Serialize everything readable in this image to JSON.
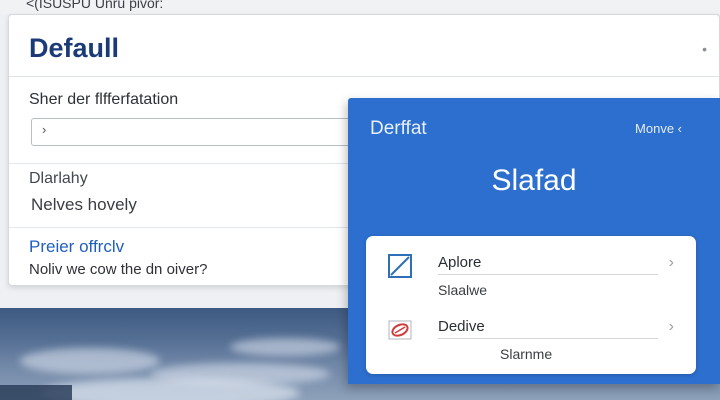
{
  "colors": {
    "accent_blue": "#2d6fce",
    "title_navy": "#1b3b78",
    "link_blue": "#1f5fbf",
    "card_bg": "#ffffff",
    "page_bg": "#eef0f3"
  },
  "breadcrumb": "<(ISUSPU Unru pivor:",
  "main": {
    "title": "Defaull",
    "header_dot": "•",
    "field_label": "Sher der flfferfatation",
    "input": {
      "value": "",
      "caret": "›"
    },
    "option_label": "Dlarlahy",
    "option_value": "Nelves hovely",
    "privacy_link": "Preier offrclv",
    "privacy_desc": "Noliv we cow the dn oiver?"
  },
  "panel": {
    "title": "Derffat",
    "more": "Monve ‹",
    "heading": "Slafad",
    "items": [
      {
        "title": "Aplore",
        "subtitle": "Slaalwe",
        "icon": "square-diagonal-icon",
        "chevron": "›"
      },
      {
        "title": "Dedive",
        "subtitle": "Slarnme",
        "icon": "red-tag-icon",
        "chevron": "›"
      }
    ]
  }
}
